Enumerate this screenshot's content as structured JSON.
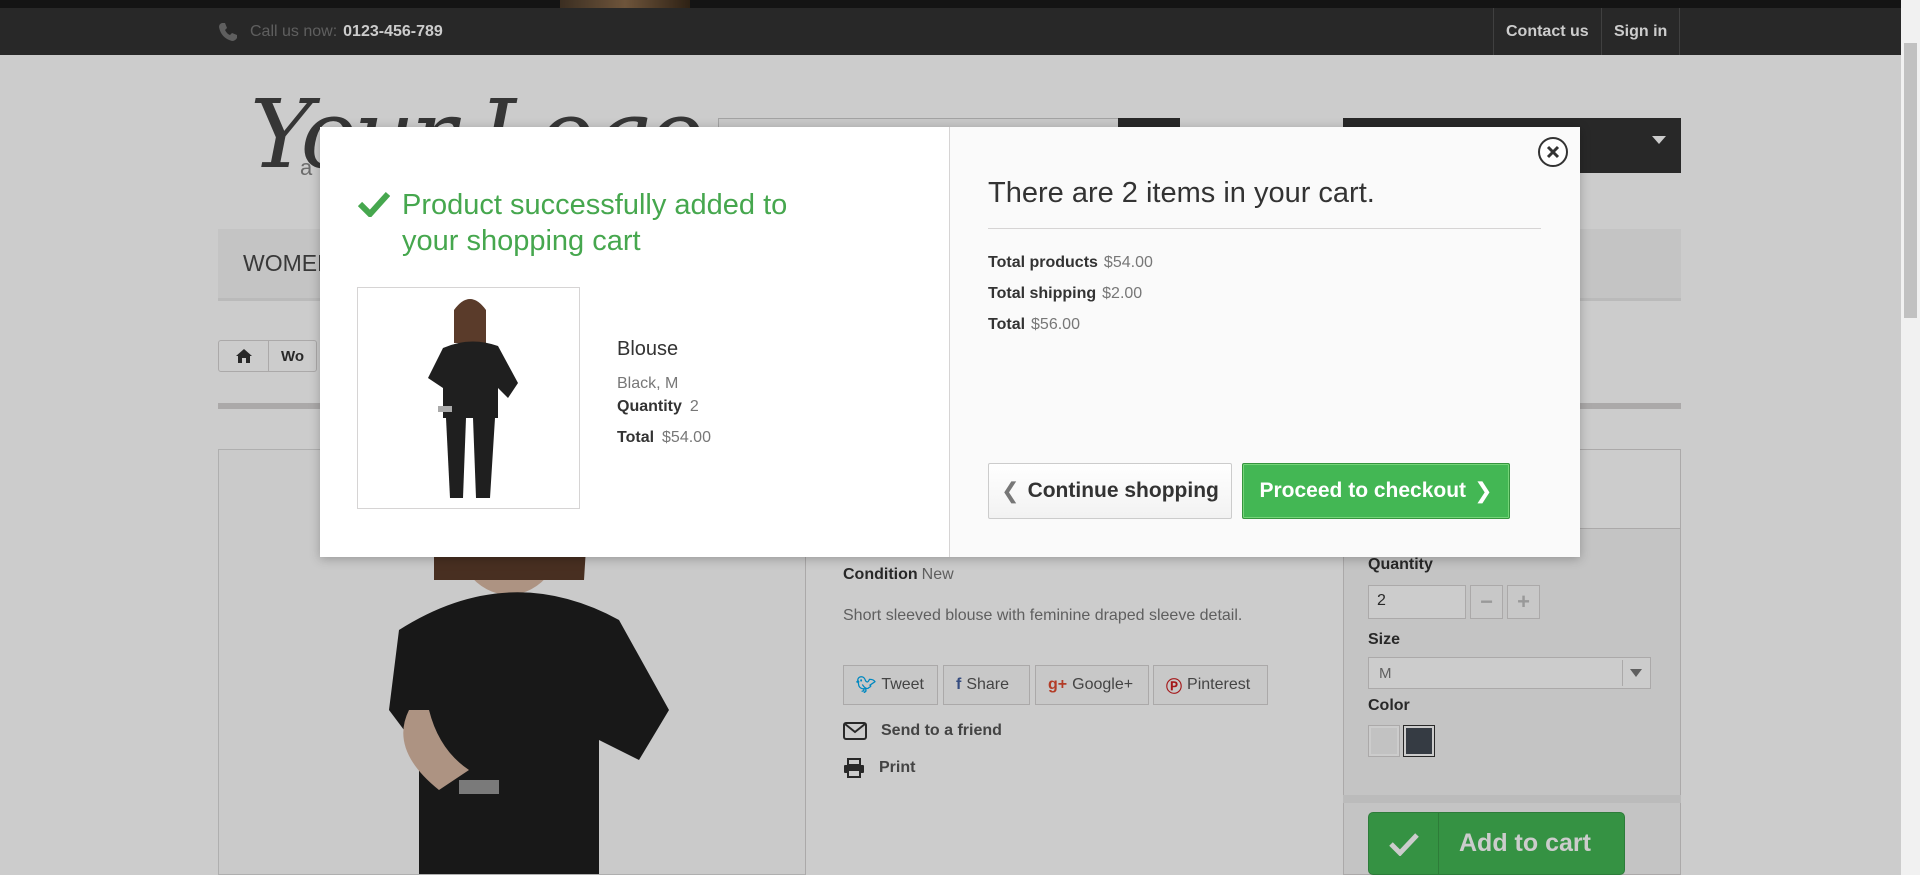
{
  "header": {
    "call_label": "Call us now:",
    "phone": "0123-456-789",
    "contact_label": "Contact us",
    "signin_label": "Sign in"
  },
  "logo": {
    "text": "Your Logo",
    "sub": "a"
  },
  "menu": {
    "first_item": "WOMEN"
  },
  "breadcrumb": {
    "crumb": "Wo"
  },
  "product_page": {
    "condition_label": "Condition",
    "condition_value": "New",
    "description": "Short sleeved blouse with feminine draped sleeve detail.",
    "social": {
      "tweet": "Tweet",
      "share": "Share",
      "google": "Google+",
      "pinterest": "Pinterest"
    },
    "send_friend": "Send to a friend",
    "print": "Print",
    "quantity_label": "Quantity",
    "quantity_value": "2",
    "size_label": "Size",
    "size_value": "M",
    "color_label": "Color",
    "colors": [
      "#f3f3f3",
      "#434a54"
    ],
    "add_to_cart": "Add to cart"
  },
  "modal": {
    "success_message": "Product successfully added to your shopping cart",
    "product": {
      "name": "Blouse",
      "attributes": "Black, M",
      "quantity_label": "Quantity",
      "quantity": "2",
      "total_label": "Total",
      "total": "$54.00"
    },
    "cart_title": "There are 2 items in your cart.",
    "summary": {
      "products_label": "Total products",
      "products_value": "$54.00",
      "shipping_label": "Total shipping",
      "shipping_value": "$2.00",
      "total_label": "Total",
      "total_value": "$56.00"
    },
    "continue_label": "Continue shopping",
    "checkout_label": "Proceed to checkout"
  },
  "colors": {
    "success_green": "#46a74e",
    "button_green": "#43b754",
    "top_bar": "#333333"
  },
  "icons": [
    "phone-icon",
    "home-icon",
    "envelope-icon",
    "printer-icon",
    "check-icon",
    "close-icon",
    "chevron-left-icon",
    "chevron-right-icon"
  ]
}
